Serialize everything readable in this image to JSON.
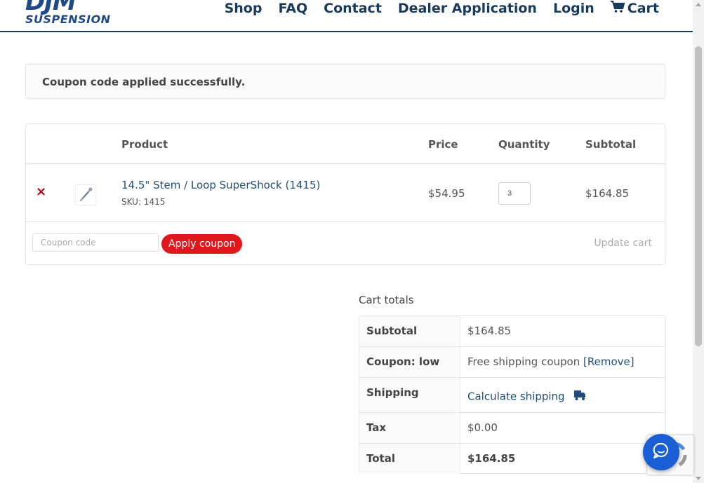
{
  "header": {
    "logo_text": "DJM",
    "logo_sub": "SUSPENSION",
    "nav": [
      "Shop",
      "FAQ",
      "Contact",
      "Dealer Application",
      "Login",
      "Cart"
    ],
    "accent": "#1a3a5c"
  },
  "notice": {
    "message": "Coupon code applied successfully."
  },
  "cart": {
    "headers": {
      "product": "Product",
      "price": "Price",
      "quantity": "Quantity",
      "subtotal": "Subtotal"
    },
    "item": {
      "remove": "×",
      "name": "14.5\" Stem / Loop SuperShock (1415)",
      "sku": "SKU: 1415",
      "price": "$54.95",
      "quantity": "3",
      "subtotal": "$164.85"
    },
    "coupon_placeholder": "Coupon code",
    "apply_label": "Apply coupon",
    "update_label": "Update cart"
  },
  "totals": {
    "title": "Cart totals",
    "subtotal_label": "Subtotal",
    "subtotal_value": "$164.85",
    "coupon_label": "Coupon: low",
    "coupon_value": "Free shipping coupon",
    "coupon_remove": "[Remove]",
    "shipping_label": "Shipping",
    "shipping_link": "Calculate shipping",
    "tax_label": "Tax",
    "tax_value": "$0.00",
    "total_label": "Total",
    "total_value": "$164.85"
  },
  "colors": {
    "button_red": "#e1171e",
    "link_blue": "#1f4c7a",
    "remove_red": "#b3000d",
    "chat_blue": "#1a5fd6"
  },
  "icons": [
    "cart-icon",
    "remove-icon",
    "product-thumbnail",
    "truck-icon",
    "chat-icon"
  ]
}
